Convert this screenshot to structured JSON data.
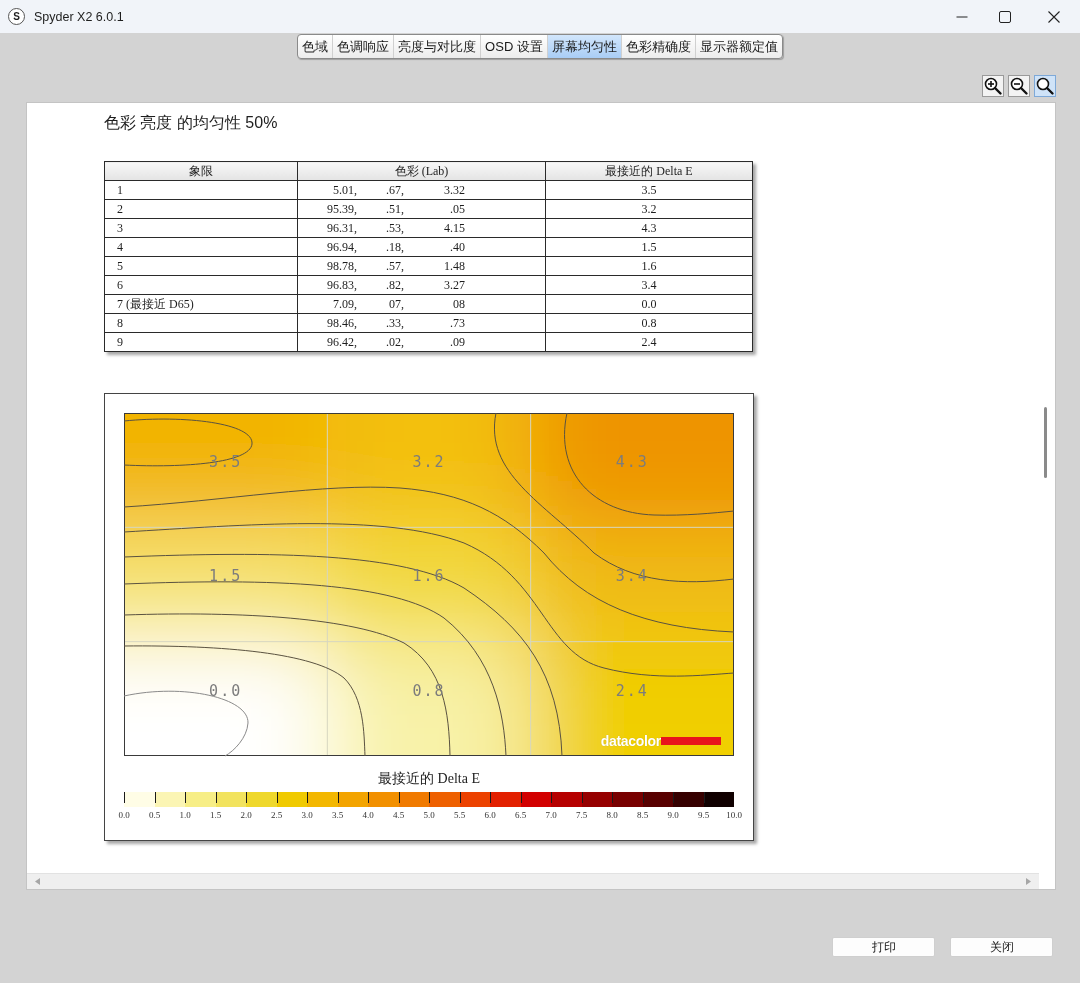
{
  "window": {
    "logo_letter": "S",
    "title": "Spyder X2 6.0.1"
  },
  "tabs": [
    {
      "label": "色域",
      "selected": false
    },
    {
      "label": "色调响应",
      "selected": false
    },
    {
      "label": "亮度与对比度",
      "selected": false
    },
    {
      "label": "OSD 设置",
      "selected": false
    },
    {
      "label": "屏幕均匀性",
      "selected": true
    },
    {
      "label": "色彩精确度",
      "selected": false
    },
    {
      "label": "显示器额定值",
      "selected": false
    }
  ],
  "zoom_tools": [
    {
      "kind": "zoom-in",
      "selected": false
    },
    {
      "kind": "zoom-out",
      "selected": false
    },
    {
      "kind": "zoom-actual",
      "selected": true
    }
  ],
  "report": {
    "title": "色彩 亮度 的均匀性 50%",
    "table": {
      "columns": [
        "象限",
        "色彩 (Lab)",
        "最接近的 Delta E"
      ],
      "rows": [
        {
          "quadrant": "1",
          "lab": [
            "5.01,",
            ".67,",
            "3.32"
          ],
          "delta_e": "3.5"
        },
        {
          "quadrant": "2",
          "lab": [
            "95.39,",
            ".51,",
            ".05"
          ],
          "delta_e": "3.2"
        },
        {
          "quadrant": "3",
          "lab": [
            "96.31,",
            ".53,",
            "4.15"
          ],
          "delta_e": "4.3"
        },
        {
          "quadrant": "4",
          "lab": [
            "96.94,",
            ".18,",
            ".40"
          ],
          "delta_e": "1.5"
        },
        {
          "quadrant": "5",
          "lab": [
            "98.78,",
            ".57,",
            "1.48"
          ],
          "delta_e": "1.6"
        },
        {
          "quadrant": "6",
          "lab": [
            "96.83,",
            ".82,",
            "3.27"
          ],
          "delta_e": "3.4"
        },
        {
          "quadrant": "7 (最接近 D65)",
          "lab": [
            "7.09,",
            "07,",
            "08"
          ],
          "delta_e": "0.0"
        },
        {
          "quadrant": "8",
          "lab": [
            "98.46,",
            ".33,",
            ".73"
          ],
          "delta_e": "0.8"
        },
        {
          "quadrant": "9",
          "lab": [
            "96.42,",
            ".02,",
            ".09"
          ],
          "delta_e": "2.4"
        }
      ]
    },
    "heatmap": {
      "cells": [
        "3.5",
        "3.2",
        "4.3",
        "1.5",
        "1.6",
        "3.4",
        "0.0",
        "0.8",
        "2.4"
      ],
      "logo": "datacolor",
      "scale": {
        "title": "最接近的 Delta E",
        "segments": [
          {
            "color": "#fffde6"
          },
          {
            "color": "#fbf5b4"
          },
          {
            "color": "#f7ee86"
          },
          {
            "color": "#f2e35e"
          },
          {
            "color": "#efd82c"
          },
          {
            "color": "#f0ca00"
          },
          {
            "color": "#f3b700"
          },
          {
            "color": "#f3a400"
          },
          {
            "color": "#f29000"
          },
          {
            "color": "#f07a00"
          },
          {
            "color": "#ee6000"
          },
          {
            "color": "#ec4200"
          },
          {
            "color": "#e22000"
          },
          {
            "color": "#d20000"
          },
          {
            "color": "#b60000"
          },
          {
            "color": "#960000"
          },
          {
            "color": "#780000"
          },
          {
            "color": "#580000"
          },
          {
            "color": "#360000"
          },
          {
            "color": "#100000"
          }
        ],
        "ticks": [
          "0.0",
          "0.5",
          "1.0",
          "1.5",
          "2.0",
          "2.5",
          "3.0",
          "3.5",
          "4.0",
          "4.5",
          "5.0",
          "5.5",
          "6.0",
          "6.5",
          "7.0",
          "7.5",
          "8.0",
          "8.5",
          "9.0",
          "9.5",
          "10.0"
        ]
      }
    }
  },
  "buttons": [
    "打印",
    "关闭"
  ]
}
